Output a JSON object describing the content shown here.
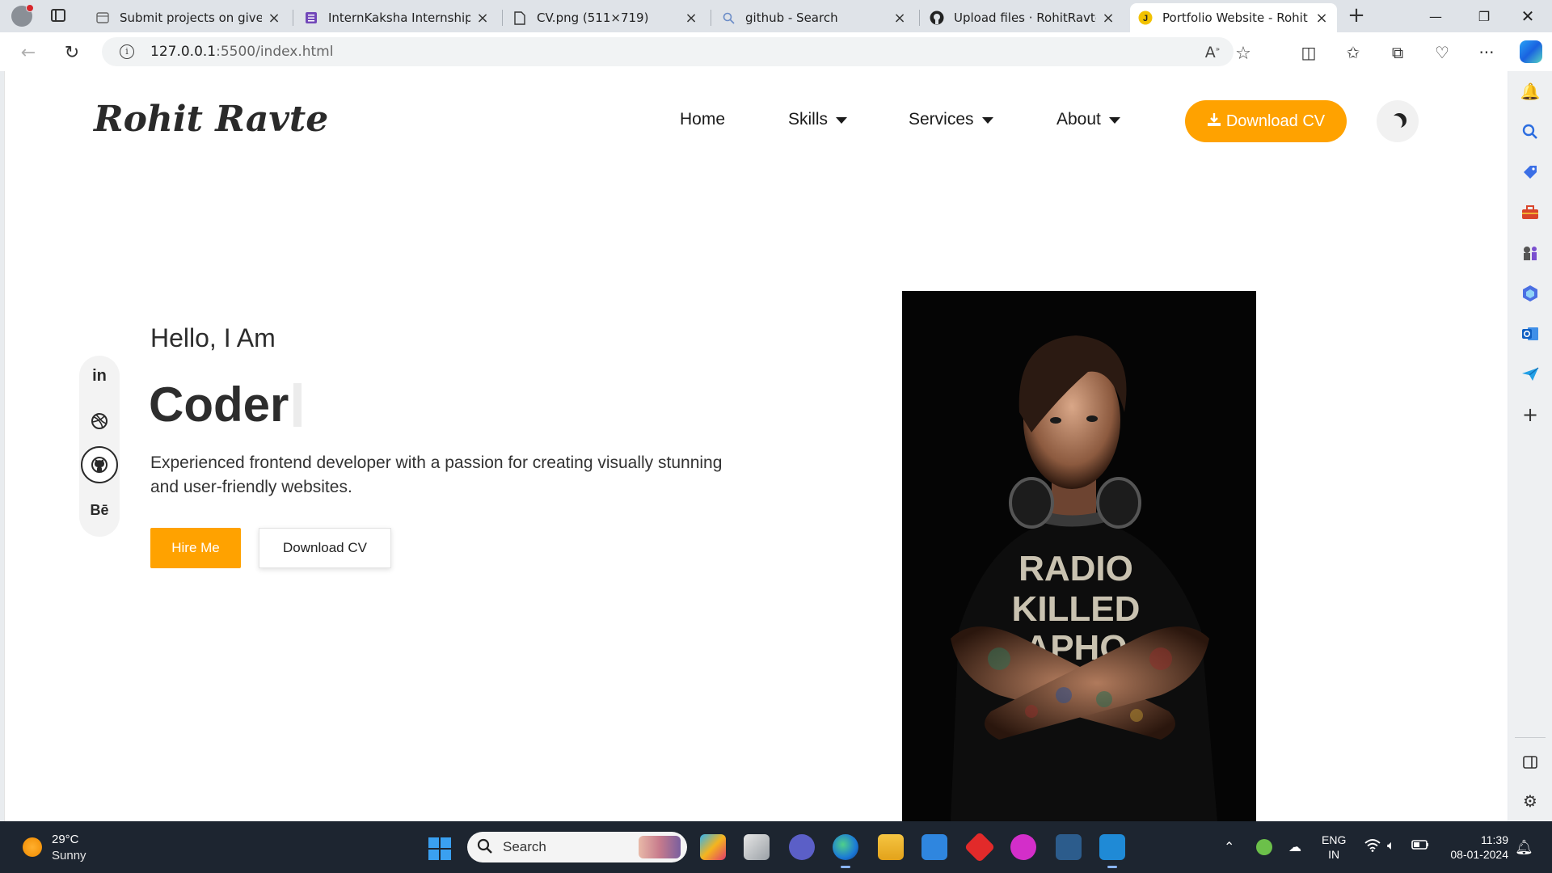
{
  "browser": {
    "tabs": [
      {
        "title": "Submit projects on given l",
        "icon": "page-icon",
        "active": false
      },
      {
        "title": "InternKaksha Internship Su",
        "icon": "forms-icon",
        "active": false
      },
      {
        "title": "CV.png (511×719)",
        "icon": "file-icon",
        "active": false
      },
      {
        "title": "github - Search",
        "icon": "search-icon",
        "active": false
      },
      {
        "title": "Upload files · RohitRavte/P",
        "icon": "github-icon",
        "active": false
      },
      {
        "title": "Portfolio Website - Rohit R",
        "icon": "portfolio-icon",
        "active": true
      }
    ],
    "url_host": "127.0.0.1",
    "url_path": ":5500/index.html"
  },
  "site": {
    "logo": "Rohit Ravte",
    "nav": [
      {
        "label": "Home",
        "dropdown": false
      },
      {
        "label": "Skills",
        "dropdown": true
      },
      {
        "label": "Services",
        "dropdown": true
      },
      {
        "label": "About",
        "dropdown": true
      }
    ],
    "download_cv": "Download CV",
    "accent_color": "#ffa200"
  },
  "hero": {
    "greeting": "Hello, I Am",
    "role": "Coder",
    "description": "Experienced frontend developer with a passion for creating visually stunning and user-friendly websites.",
    "hire_label": "Hire Me",
    "cv_label": "Download CV",
    "social": [
      {
        "label": "in",
        "icon": "linkedin-icon"
      },
      {
        "label": "dribbble",
        "icon": "dribbble-icon"
      },
      {
        "label": "github",
        "icon": "github-icon"
      },
      {
        "label": "Bē",
        "icon": "behance-icon"
      }
    ],
    "photo_shirt_text": [
      "RADIO",
      "KILLED",
      "APHO"
    ]
  },
  "taskbar": {
    "temperature": "29°C",
    "weather": "Sunny",
    "search_placeholder": "Search",
    "lang_line1": "ENG",
    "lang_line2": "IN",
    "time": "11:39",
    "date": "08-01-2024"
  }
}
